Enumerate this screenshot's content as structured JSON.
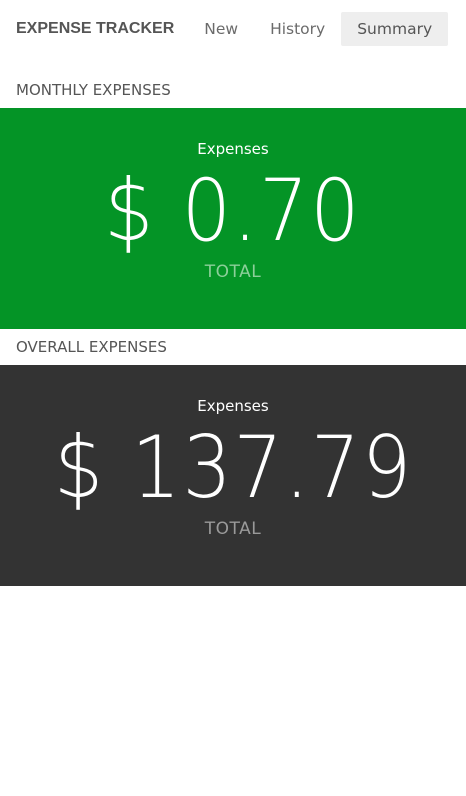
{
  "nav": {
    "brand": "EXPENSE TRACKER",
    "links": [
      "New",
      "History",
      "Summary"
    ],
    "active": "Summary"
  },
  "monthly": {
    "heading": "MONTHLY EXPENSES",
    "label": "Expenses",
    "amount": "$ 0.70",
    "total_label": "TOTAL",
    "color": "#049426"
  },
  "overall": {
    "heading": "OVERALL EXPENSES",
    "label": "Expenses",
    "amount": "$ 137.79",
    "total_label": "TOTAL",
    "color": "#333333"
  }
}
